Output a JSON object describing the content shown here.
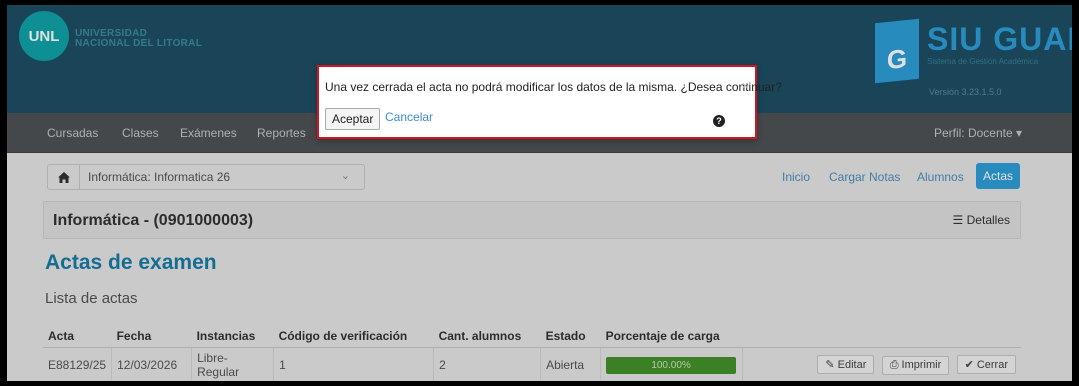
{
  "header": {
    "logo_text": "UNL",
    "university_line1": "UNIVERSIDAD",
    "university_line2": "NACIONAL DEL LITORAL",
    "siu_letter": "G",
    "siu_word": "SIU GUARANÍ",
    "siu_tagline": "Sistema de Gestión Académica",
    "version": "Versión 3.23.1.5.0"
  },
  "nav": {
    "items": [
      "Cursadas",
      "Clases",
      "Exámenes",
      "Reportes"
    ],
    "profile": "Perfil: Docente ▾"
  },
  "breadcrumb": {
    "home_icon": "home-icon",
    "label": "Informática: Informatica 26",
    "caret": "⌄"
  },
  "tabs": [
    "Inicio",
    "Cargar Notas",
    "Alumnos",
    "Actas"
  ],
  "subject": {
    "title": "Informática - (0901000003)",
    "details_label": "Detalles"
  },
  "page": {
    "heading": "Actas de examen",
    "list_heading": "Lista de actas"
  },
  "table": {
    "headers": [
      "Acta",
      "Fecha",
      "Instancias",
      "Código de verificación",
      "Cant. alumnos",
      "Estado",
      "Porcentaje de carga",
      ""
    ],
    "rows": [
      {
        "acta": "E88129/25",
        "fecha": "12/03/2026",
        "instancias": "Libre-Regular",
        "codigo": "1",
        "cant": "2",
        "estado": "Abierta",
        "porcentaje": "100.00%",
        "progress_fraction": 1.0
      }
    ],
    "actions": {
      "edit": "Editar",
      "print": "Imprimir",
      "close": "Cerrar"
    }
  },
  "dialog": {
    "message": "Una vez cerrada el acta no podrá modificar los datos de la misma. ¿Desea continuar?",
    "close_symbol": "×",
    "accept": "Aceptar",
    "cancel": "Cancelar",
    "help_symbol": "?"
  },
  "colors": {
    "header_bg": "#1e4f66",
    "accent": "#2d9fd8",
    "heading": "#1a7ba6",
    "dialog_border": "#d4151f",
    "progress": "#44922b"
  }
}
